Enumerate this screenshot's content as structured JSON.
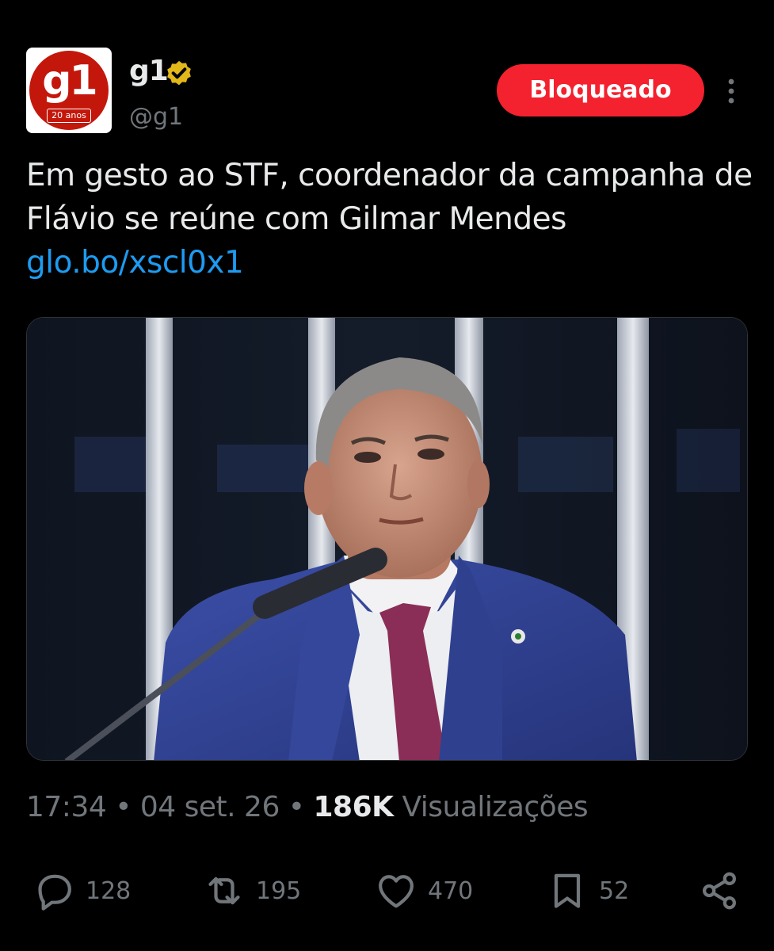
{
  "author": {
    "avatar_text": "g1",
    "avatar_badge": "20 anos",
    "display_name": "g1",
    "handle": "@g1",
    "verified": "verified-gold-badge-icon"
  },
  "follow_state_button": "Bloqueado",
  "tweet": {
    "text": "Em gesto ao STF, coordenador da campanha de Flávio se reúne com Gilmar Mendes ",
    "link": "glo.bo/xscl0x1"
  },
  "meta": {
    "time": "17:34",
    "separator": " • ",
    "date": "04 set. 26",
    "views_count": "186K",
    "views_label": " Visualizações"
  },
  "actions": {
    "replies": "128",
    "reposts": "195",
    "likes": "470",
    "bookmarks": "52"
  },
  "colors": {
    "background": "#000000",
    "text": "#e7e9ea",
    "muted": "#71767b",
    "link": "#1d9bf0",
    "blocked": "#f4212e",
    "verified": "#e2b719",
    "brand": "#c4170c"
  }
}
